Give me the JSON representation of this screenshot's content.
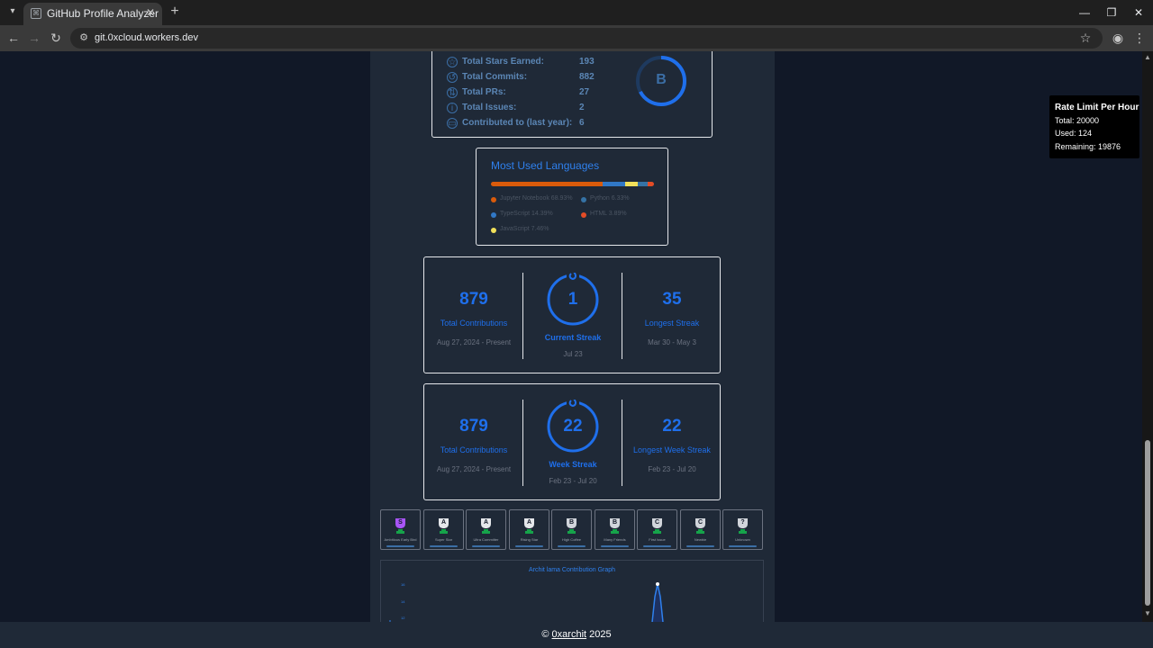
{
  "browser": {
    "tab_title": "GitHub Profile Analyzer",
    "url": "git.0xcloud.workers.dev"
  },
  "stats": {
    "rows": [
      {
        "label": "Total Stars Earned:",
        "value": "193",
        "icon": "star-icon"
      },
      {
        "label": "Total Commits:",
        "value": "882",
        "icon": "history-icon"
      },
      {
        "label": "Total PRs:",
        "value": "27",
        "icon": "pull-request-icon"
      },
      {
        "label": "Total Issues:",
        "value": "2",
        "icon": "issue-icon"
      },
      {
        "label": "Contributed to (last year):",
        "value": "6",
        "icon": "repo-icon"
      }
    ],
    "rank": "B"
  },
  "languages": {
    "title": "Most Used Languages",
    "items": [
      {
        "name": "Jupyter Notebook 68.93%",
        "percent": 68.93,
        "color": "#DA5B0B"
      },
      {
        "name": "Python 6.33%",
        "percent": 6.33,
        "color": "#3572A5"
      },
      {
        "name": "TypeScript 14.39%",
        "percent": 14.39,
        "color": "#3178C6"
      },
      {
        "name": "HTML 3.89%",
        "percent": 3.89,
        "color": "#E34C26"
      },
      {
        "name": "JavaScript 7.46%",
        "percent": 7.46,
        "color": "#F1E05A"
      }
    ]
  },
  "streak_daily": {
    "total": "879",
    "total_label": "Total Contributions",
    "total_range": "Aug 27, 2024 - Present",
    "current": "1",
    "current_label": "Current Streak",
    "current_range": "Jul 23",
    "longest": "35",
    "longest_label": "Longest Streak",
    "longest_range": "Mar 30 - May 3"
  },
  "streak_weekly": {
    "total": "879",
    "total_label": "Total Contributions",
    "total_range": "Aug 27, 2024 - Present",
    "current": "22",
    "current_label": "Week Streak",
    "current_range": "Feb 23 - Jul 20",
    "longest": "22",
    "longest_label": "Longest Week Streak",
    "longest_range": "Feb 23 - Jul 20"
  },
  "trophies": [
    {
      "rank": "S",
      "sub": "Ambitious Early Bird"
    },
    {
      "rank": "A",
      "sub": "Super Star"
    },
    {
      "rank": "A",
      "sub": "Ultra Committer"
    },
    {
      "rank": "A",
      "sub": "Rising Star"
    },
    {
      "rank": "B",
      "sub": "High Coffee"
    },
    {
      "rank": "B",
      "sub": "Many Friends"
    },
    {
      "rank": "C",
      "sub": "First Issue"
    },
    {
      "rank": "C",
      "sub": "Newbie"
    },
    {
      "rank": "?",
      "sub": "Unknown"
    }
  ],
  "graph": {
    "title": "Archit lama Contribution Graph",
    "ticks": [
      "16",
      "14",
      "12"
    ]
  },
  "rate_limit": {
    "title": "Rate Limit Per Hour",
    "total": "Total: 20000",
    "used": "Used: 124",
    "remaining": "Remaining: 19876"
  },
  "footer": {
    "prefix": "©",
    "link": "0xarchit",
    "suffix": "2025"
  },
  "colors": {
    "accent": "#1f6feb",
    "page_bg": "#111827",
    "card_bg": "#1f2937"
  }
}
